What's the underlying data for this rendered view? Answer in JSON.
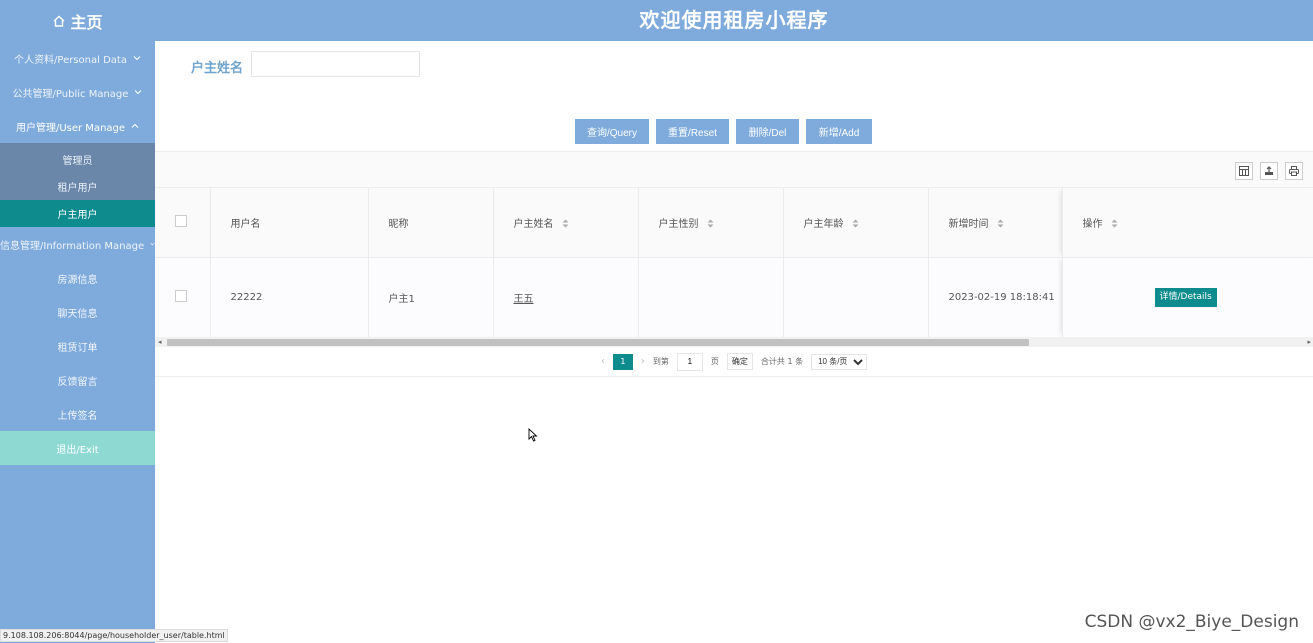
{
  "header": {
    "home_label": "主页",
    "title": "欢迎使用租房小程序"
  },
  "sidebar": {
    "groups": [
      {
        "label": "个人资料/Personal Data"
      },
      {
        "label": "公共管理/Public Manage"
      },
      {
        "label": "用户管理/User Manage"
      },
      {
        "label": "信息管理/Information Manage"
      }
    ],
    "user_items": [
      "管理员",
      "租户用户",
      "户主用户"
    ],
    "info_items": [
      "房源信息",
      "聊天信息",
      "租赁订单",
      "反馈留言",
      "上传签名"
    ],
    "exit_label": "退出/Exit"
  },
  "search": {
    "label": "户主姓名",
    "value": ""
  },
  "buttons": {
    "query": "查询/Query",
    "reset": "重置/Reset",
    "delete": "删除/Del",
    "add": "新增/Add"
  },
  "table": {
    "columns": [
      "用户名",
      "昵称",
      "户主姓名",
      "户主性别",
      "户主年龄",
      "新增时间",
      "操作"
    ],
    "rows": [
      {
        "username": "22222",
        "nickname": "户主1",
        "name": "王五",
        "gender": "",
        "age": "",
        "created": "2023-02-19 18:18:41",
        "action": "详情/Details"
      }
    ]
  },
  "pagination": {
    "current": "1",
    "goto_label": "到第",
    "goto_value": "1",
    "page_unit": "页",
    "confirm": "确定",
    "total": "合计共 1 条",
    "per_page": "10 条/页"
  },
  "status_url": "9.108.108.206:8044/page/householder_user/table.html",
  "watermark": "CSDN @vx2_Biye_Design"
}
